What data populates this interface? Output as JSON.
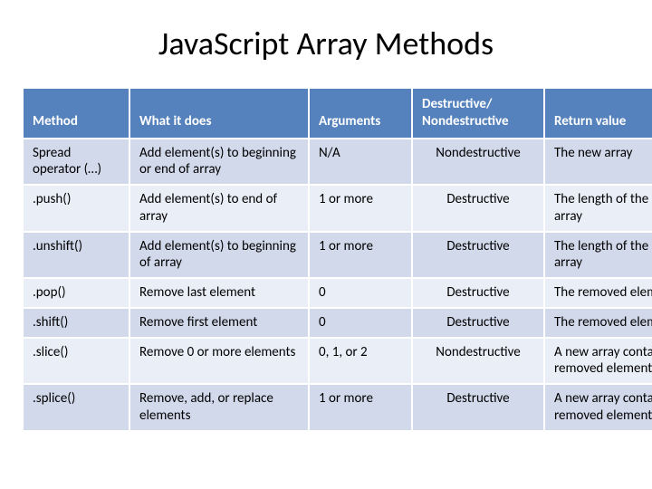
{
  "title": "JavaScript Array Methods",
  "columns": {
    "method": "Method",
    "what": "What it does",
    "args": "Arguments",
    "destr": "Destructive/ Nondestructive",
    "ret": "Return value"
  },
  "rows": [
    {
      "method": "Spread operator (…)",
      "what": "Add element(s) to beginning or end of array",
      "args": "N/A",
      "destr": "Nondestructive",
      "ret": "The new array"
    },
    {
      "method": ".push()",
      "what": "Add element(s) to end of array",
      "args": "1 or more",
      "destr": "Destructive",
      "ret": "The length of the modified array"
    },
    {
      "method": ".unshift()",
      "what": "Add element(s) to beginning of array",
      "args": "1 or more",
      "destr": "Destructive",
      "ret": "The length of the modified array"
    },
    {
      "method": ".pop()",
      "what": "Remove last element",
      "args": "0",
      "destr": "Destructive",
      "ret": "The removed element"
    },
    {
      "method": ".shift()",
      "what": "Remove first element",
      "args": "0",
      "destr": "Destructive",
      "ret": "The removed element"
    },
    {
      "method": ".slice()",
      "what": "Remove 0 or more elements",
      "args": "0, 1, or 2",
      "destr": "Nondestructive",
      "ret": "A new array containing the removed elements"
    },
    {
      "method": ".splice()",
      "what": "Remove, add, or replace elements",
      "args": "1 or more",
      "destr": "Destructive",
      "ret": "A new array containing the removed elements"
    }
  ]
}
